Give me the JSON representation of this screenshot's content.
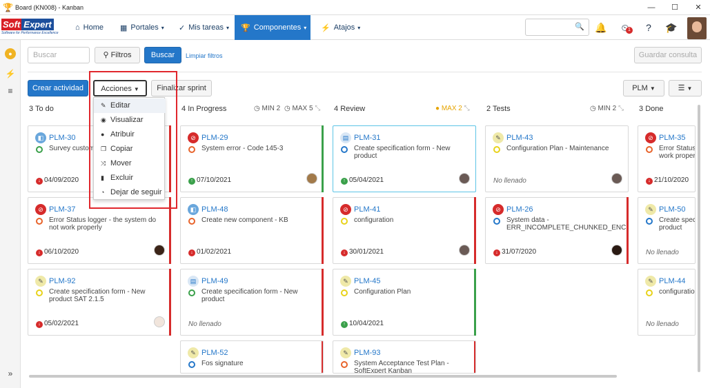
{
  "window": {
    "title": "Board (KN008) - Kanban",
    "controls": [
      "minimize-icon",
      "maximize-icon",
      "close-icon"
    ]
  },
  "logo": {
    "soft": "Soft",
    "expert": "Expert",
    "tagline": "Software for Performance Excellence"
  },
  "nav": {
    "home": "Home",
    "portales": "Portales",
    "mis_tareas": "Mis tareas",
    "componentes": "Componentes",
    "atajos": "Atajos",
    "notif_badge": "1"
  },
  "toolbar": {
    "search_placeholder": "Buscar",
    "filters_label": "Filtros",
    "search_button": "Buscar",
    "clear_filters": "Limpiar filtros",
    "save_query": "Guardar consulta",
    "create_activity": "Crear actividad",
    "actions": "Acciones",
    "finish_sprint": "Finalizar sprint",
    "plm_select": "PLM"
  },
  "columns": [
    {
      "count": "3",
      "name": "To do",
      "min": "",
      "max": ""
    },
    {
      "count": "4",
      "name": "In Progress",
      "min": "MIN 2",
      "max": "MAX 5"
    },
    {
      "count": "4",
      "name": "Review",
      "min": "",
      "max": "MAX 2"
    },
    {
      "count": "2",
      "name": "Tests",
      "min": "MIN 2",
      "max": ""
    },
    {
      "count": "3",
      "name": "Done",
      "min": "",
      "max": ""
    }
  ],
  "cards": [
    {
      "id": "PLM-30",
      "title": "Survey custom",
      "date": "04/09/2020"
    },
    {
      "id": "PLM-37",
      "title": "Error Status logger - the system do not work properly",
      "date": "06/10/2020"
    },
    {
      "id": "PLM-92",
      "title": "Create specification form - New product SAT 2.1.5",
      "date": "05/02/2021"
    },
    {
      "id": "PLM-29",
      "title": "System error - Code 145-3",
      "date": "07/10/2021"
    },
    {
      "id": "PLM-48",
      "title": "Create new component - KB",
      "date": "01/02/2021"
    },
    {
      "id": "PLM-49",
      "title": "Create specification form - New product",
      "date": "No llenado"
    },
    {
      "id": "PLM-52",
      "title": "Fos signature",
      "date": ""
    },
    {
      "id": "PLM-31",
      "title": "Create specification form - New product",
      "date": "05/04/2021"
    },
    {
      "id": "PLM-41",
      "title": "configuration",
      "date": "30/01/2021"
    },
    {
      "id": "PLM-45",
      "title": "Configuration Plan",
      "date": "10/04/2021"
    },
    {
      "id": "PLM-93",
      "title": "System Acceptance Test Plan - SoftExpert Kanban",
      "date": ""
    },
    {
      "id": "PLM-43",
      "title": "Configuration Plan - Maintenance",
      "date": "No llenado"
    },
    {
      "id": "PLM-26",
      "title": "System data - ERR_INCOMPLETE_CHUNKED_ENC",
      "date": "31/07/2020"
    },
    {
      "id": "PLM-35",
      "title": "Error Status work proper",
      "date": "21/10/2020"
    },
    {
      "id": "PLM-50",
      "title": "Create spec product",
      "date": "No llenado"
    },
    {
      "id": "PLM-44",
      "title": "configuration",
      "date": "No llenado"
    }
  ],
  "actions_menu": [
    "Editar",
    "Visualizar",
    "Atribuir",
    "Copiar",
    "Mover",
    "Excluir",
    "Dejar de seguir"
  ],
  "colors": {
    "accent": "#2477c9",
    "red": "#d62b2b",
    "green": "#3aa04a",
    "warn": "#e6a400"
  }
}
